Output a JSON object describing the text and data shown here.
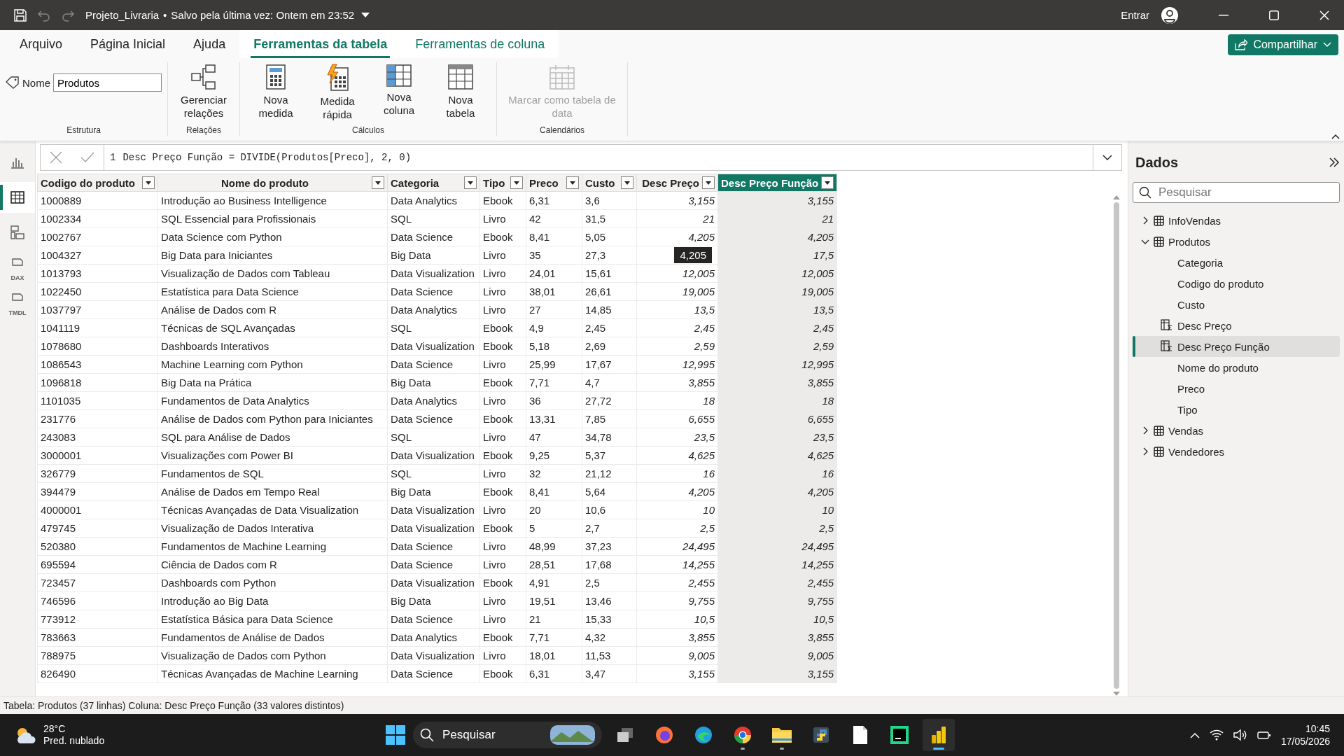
{
  "title_bar": {
    "file": "Projeto_Livraria",
    "separator": "•",
    "saved": "Salvo pela última vez: Ontem em 23:52",
    "sign_in": "Entrar"
  },
  "ribbon_tabs": [
    {
      "label": "Arquivo",
      "selected": false,
      "kind": "normal"
    },
    {
      "label": "Página Inicial",
      "selected": false,
      "kind": "normal"
    },
    {
      "label": "Ajuda",
      "selected": false,
      "kind": "normal"
    },
    {
      "label": "Ferramentas da tabela",
      "selected": true,
      "kind": "contextual"
    },
    {
      "label": "Ferramentas de coluna",
      "selected": false,
      "kind": "contextual"
    }
  ],
  "share_button": "Compartilhar",
  "ribbon_groups": [
    {
      "title": "Estrutura",
      "kind": "name",
      "label": "Nome",
      "value": "Produtos"
    },
    {
      "title": "Relações",
      "kind": "buttons",
      "buttons": [
        {
          "label": "Gerenciar relações",
          "kind": "relations",
          "disabled": false
        }
      ]
    },
    {
      "title": "Cálculos",
      "kind": "buttons",
      "buttons": [
        {
          "label": "Nova medida",
          "kind": "calculator",
          "disabled": false
        },
        {
          "label": "Medida rápida",
          "kind": "quick",
          "disabled": false
        },
        {
          "label": "Nova coluna",
          "kind": "column",
          "disabled": false
        },
        {
          "label": "Nova tabela",
          "kind": "table",
          "disabled": false
        }
      ]
    },
    {
      "title": "Calendários",
      "kind": "buttons",
      "buttons": [
        {
          "label": "Marcar como tabela de data",
          "kind": "calendar",
          "disabled": true
        }
      ]
    }
  ],
  "rail": [
    {
      "kind": "report",
      "selected": false
    },
    {
      "kind": "table",
      "selected": true
    },
    {
      "kind": "model",
      "selected": false
    },
    {
      "kind": "dax",
      "selected": false,
      "label": "DAX"
    },
    {
      "kind": "tmdl",
      "selected": false,
      "label": "TMDL"
    }
  ],
  "formula_bar": {
    "line": "1",
    "formula": "Desc Preço Função = DIVIDE(Produtos[Preco], 2, 0)"
  },
  "table": {
    "columns": [
      {
        "label": "Codigo do produto",
        "selected": false
      },
      {
        "label": "Nome do produto",
        "selected": false
      },
      {
        "label": "Categoria",
        "selected": false
      },
      {
        "label": "Tipo",
        "selected": false
      },
      {
        "label": "Preco",
        "selected": false
      },
      {
        "label": "Custo",
        "selected": false
      },
      {
        "label": "Desc Preço",
        "selected": false
      },
      {
        "label": "Desc Preço Função",
        "selected": true
      }
    ],
    "rows": [
      [
        "1000889",
        "Introdução ao Business Intelligence",
        "Data Analytics",
        "Ebook",
        "6,31",
        "3,6",
        "3,155",
        "3,155"
      ],
      [
        "1002334",
        "SQL Essencial para Profissionais",
        "SQL",
        "Livro",
        "42",
        "31,5",
        "21",
        "21"
      ],
      [
        "1002767",
        "Data Science com Python",
        "Data Science",
        "Ebook",
        "8,41",
        "5,05",
        "4,205",
        "4,205"
      ],
      [
        "1004327",
        "Big Data para Iniciantes",
        "Big Data",
        "Livro",
        "35",
        "27,3",
        {
          "tooltip": "4,205"
        },
        "17,5"
      ],
      [
        "1013793",
        "Visualização de Dados com Tableau",
        "Data Visualization",
        "Livro",
        "24,01",
        "15,61",
        "12,005",
        "12,005"
      ],
      [
        "1022450",
        "Estatística para Data Science",
        "Data Science",
        "Livro",
        "38,01",
        "26,61",
        "19,005",
        "19,005"
      ],
      [
        "1037797",
        "Análise de Dados com R",
        "Data Analytics",
        "Livro",
        "27",
        "14,85",
        "13,5",
        "13,5"
      ],
      [
        "1041119",
        "Técnicas de SQL Avançadas",
        "SQL",
        "Ebook",
        "4,9",
        "2,45",
        "2,45",
        "2,45"
      ],
      [
        "1078680",
        "Dashboards Interativos",
        "Data Visualization",
        "Ebook",
        "5,18",
        "2,69",
        "2,59",
        "2,59"
      ],
      [
        "1086543",
        "Machine Learning com Python",
        "Data Science",
        "Livro",
        "25,99",
        "17,67",
        "12,995",
        "12,995"
      ],
      [
        "1096818",
        "Big Data na Prática",
        "Big Data",
        "Ebook",
        "7,71",
        "4,7",
        "3,855",
        "3,855"
      ],
      [
        "1101035",
        "Fundamentos de Data Analytics",
        "Data Analytics",
        "Livro",
        "36",
        "27,72",
        "18",
        "18"
      ],
      [
        "231776",
        "Análise de Dados com Python para Iniciantes",
        "Data Science",
        "Ebook",
        "13,31",
        "7,85",
        "6,655",
        "6,655"
      ],
      [
        "243083",
        "SQL para Análise de Dados",
        "SQL",
        "Livro",
        "47",
        "34,78",
        "23,5",
        "23,5"
      ],
      [
        "3000001",
        "Visualizações com Power BI",
        "Data Visualization",
        "Ebook",
        "9,25",
        "5,37",
        "4,625",
        "4,625"
      ],
      [
        "326779",
        "Fundamentos de SQL",
        "SQL",
        "Livro",
        "32",
        "21,12",
        "16",
        "16"
      ],
      [
        "394479",
        "Análise de Dados em Tempo Real",
        "Big Data",
        "Ebook",
        "8,41",
        "5,64",
        "4,205",
        "4,205"
      ],
      [
        "4000001",
        "Técnicas Avançadas de Data Visualization",
        "Data Visualization",
        "Livro",
        "20",
        "10,6",
        "10",
        "10"
      ],
      [
        "479745",
        "Visualização de Dados Interativa",
        "Data Visualization",
        "Ebook",
        "5",
        "2,7",
        "2,5",
        "2,5"
      ],
      [
        "520380",
        "Fundamentos de Machine Learning",
        "Data Science",
        "Livro",
        "48,99",
        "37,23",
        "24,495",
        "24,495"
      ],
      [
        "695594",
        "Ciência de Dados com R",
        "Data Science",
        "Livro",
        "28,51",
        "17,68",
        "14,255",
        "14,255"
      ],
      [
        "723457",
        "Dashboards com Python",
        "Data Visualization",
        "Ebook",
        "4,91",
        "2,5",
        "2,455",
        "2,455"
      ],
      [
        "746596",
        "Introdução ao Big Data",
        "Big Data",
        "Livro",
        "19,51",
        "13,46",
        "9,755",
        "9,755"
      ],
      [
        "773912",
        "Estatística Básica para Data Science",
        "Data Science",
        "Livro",
        "21",
        "15,33",
        "10,5",
        "10,5"
      ],
      [
        "783663",
        "Fundamentos de Análise de Dados",
        "Data Analytics",
        "Ebook",
        "7,71",
        "4,32",
        "3,855",
        "3,855"
      ],
      [
        "788975",
        "Visualização de Dados com Python",
        "Data Visualization",
        "Livro",
        "18,01",
        "11,53",
        "9,005",
        "9,005"
      ],
      [
        "826490",
        "Técnicas Avançadas de Machine Learning",
        "Data Science",
        "Ebook",
        "6,31",
        "3,47",
        "3,155",
        "3,155"
      ]
    ]
  },
  "data_pane": {
    "title": "Dados",
    "search": {
      "placeholder": "Pesquisar"
    },
    "tree": [
      {
        "label": "InfoVendas",
        "kind": "table",
        "expanded": false,
        "selected": false
      },
      {
        "label": "Produtos",
        "kind": "table",
        "expanded": true,
        "selected": false,
        "children": [
          {
            "label": "Categoria",
            "kind": "field",
            "selected": false
          },
          {
            "label": "Codigo do produto",
            "kind": "field",
            "selected": false
          },
          {
            "label": "Custo",
            "kind": "field",
            "selected": false
          },
          {
            "label": "Desc Preço",
            "kind": "calculated",
            "selected": false
          },
          {
            "label": "Desc Preço Função",
            "kind": "calculated",
            "selected": true
          },
          {
            "label": "Nome do produto",
            "kind": "field",
            "selected": false
          },
          {
            "label": "Preco",
            "kind": "field",
            "selected": false
          },
          {
            "label": "Tipo",
            "kind": "field",
            "selected": false
          }
        ]
      },
      {
        "label": "Vendas",
        "kind": "table",
        "expanded": false,
        "selected": false
      },
      {
        "label": "Vendedores",
        "kind": "table",
        "expanded": false,
        "selected": false
      }
    ]
  },
  "status_bar": "Tabela: Produtos (37 linhas) Coluna: Desc Preço Função (33 valores distintos)",
  "taskbar": {
    "temperature": "28°C",
    "weather": "Pred. nublado",
    "search": {
      "placeholder": "Pesquisar"
    },
    "time": "10:45",
    "date": "17/05/2026",
    "apps": [
      {
        "kind": "taskview",
        "running": false
      },
      {
        "kind": "firefox",
        "running": false
      },
      {
        "kind": "edge",
        "running": false
      },
      {
        "kind": "chrome",
        "running": true
      },
      {
        "kind": "explorer",
        "running": true
      },
      {
        "kind": "python",
        "running": false
      },
      {
        "kind": "file",
        "running": false
      },
      {
        "kind": "pycharm",
        "running": false
      },
      {
        "kind": "powerbi",
        "running": true
      }
    ]
  }
}
